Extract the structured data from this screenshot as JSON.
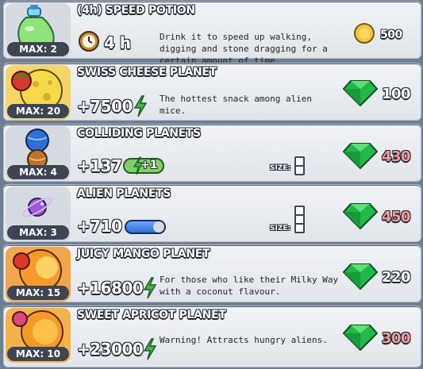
{
  "colors": {
    "gem_price_white": "#ffffff",
    "gem_price_red": "#f29a9a",
    "gem_green": "#23b84a",
    "coin_gold": "#f4c542",
    "bolt_green": "#47b34a",
    "blue_pill": "#2f6fd6"
  },
  "items": [
    {
      "title": "(4h) SPEED POTION",
      "max": "MAX: 2",
      "value": "4 h",
      "value_icon": "clock-icon",
      "description": "Drink it to speed up walking, digging and stone dragging for a certain amount of time.",
      "price": "500",
      "currency": "coin"
    },
    {
      "title": "SWISS CHEESE PLANET",
      "max": "MAX: 20",
      "value": "+7500",
      "value_icon": "bolt-icon",
      "description": "The hottest snack among alien mice.",
      "price": "100",
      "currency": "gem"
    },
    {
      "title": "COLLIDING PLANETS",
      "max": "MAX: 4",
      "value": "+137",
      "pill_text": "+1",
      "size_label": "SIZE:",
      "price": "430",
      "currency": "gem"
    },
    {
      "title": "ALIEN PLANETS",
      "max": "MAX: 3",
      "value": "+710",
      "size_label": "SIZE:",
      "price": "450",
      "currency": "gem"
    },
    {
      "title": "JUICY MANGO PLANET",
      "max": "MAX: 15",
      "value": "+16800",
      "value_icon": "bolt-icon",
      "description": "For those who like their Milky Way with a coconut flavour.",
      "price": "220",
      "currency": "gem"
    },
    {
      "title": "SWEET APRICOT PLANET",
      "max": "MAX: 10",
      "value": "+23000",
      "value_icon": "bolt-icon",
      "description": "Warning! Attracts hungry aliens.",
      "price": "300",
      "currency": "gem"
    }
  ]
}
